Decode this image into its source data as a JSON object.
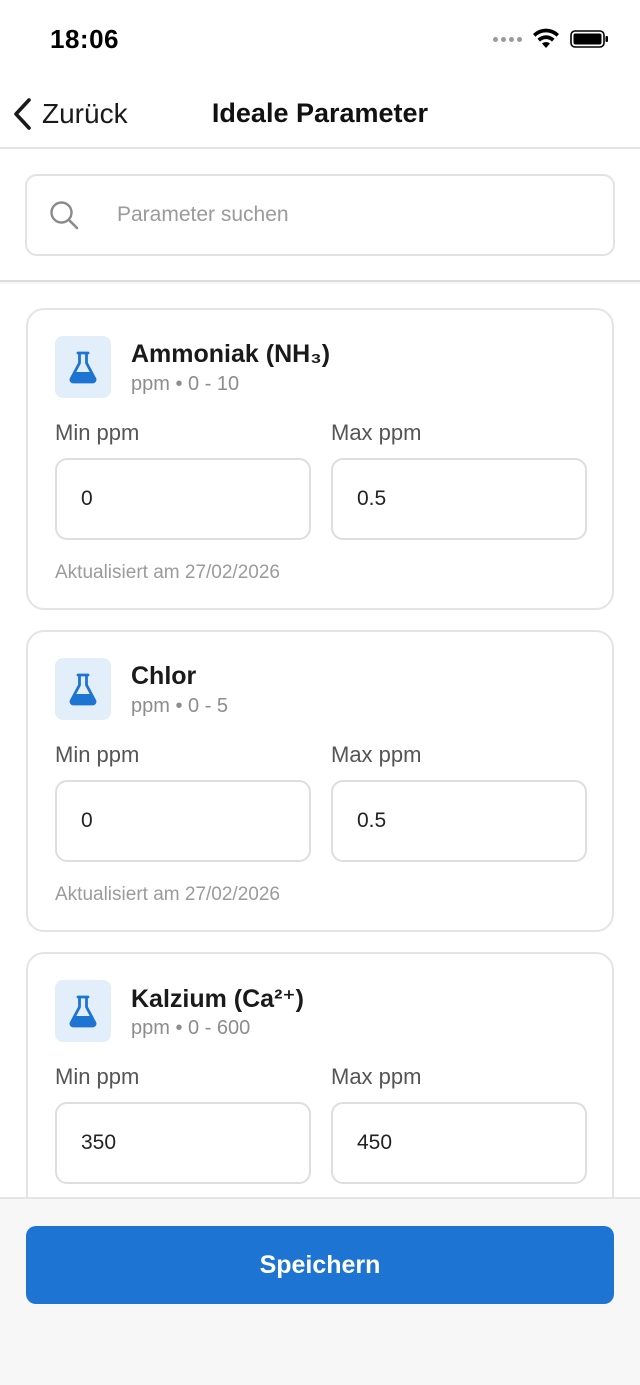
{
  "status_bar": {
    "time": "18:06",
    "icons": [
      "cellular-signal-icon",
      "wifi-icon",
      "battery-icon"
    ]
  },
  "nav": {
    "back_label": "Zurück",
    "title": "Ideale Parameter"
  },
  "search": {
    "placeholder": "Parameter suchen",
    "value": ""
  },
  "colors": {
    "accent": "#1e74d2",
    "icon_bg": "#e3eefb",
    "border": "#e4e4e4",
    "muted_text": "#8d8d8d"
  },
  "parameters": [
    {
      "name": "Ammoniak (NH₃)",
      "subtitle": "ppm • 0 - 10",
      "min_label": "Min ppm",
      "max_label": "Max ppm",
      "min_value": "0",
      "max_value": "0.5",
      "updated": "Aktualisiert am 27/02/2026",
      "icon": "flask-icon"
    },
    {
      "name": "Chlor",
      "subtitle": "ppm • 0 - 5",
      "min_label": "Min ppm",
      "max_label": "Max ppm",
      "min_value": "0",
      "max_value": "0.5",
      "updated": "Aktualisiert am 27/02/2026",
      "icon": "flask-icon"
    },
    {
      "name": "Kalzium (Ca²⁺)",
      "subtitle": "ppm • 0 - 600",
      "min_label": "Min ppm",
      "max_label": "Max ppm",
      "min_value": "350",
      "max_value": "450",
      "updated": "",
      "icon": "flask-icon"
    }
  ],
  "footer": {
    "save_label": "Speichern"
  }
}
